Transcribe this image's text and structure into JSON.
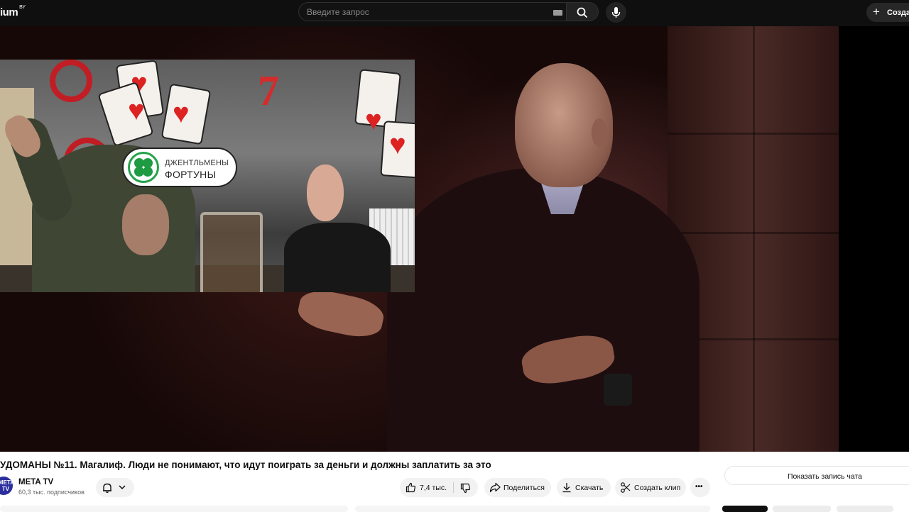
{
  "header": {
    "logo_text": "ium",
    "logo_sup": "BY",
    "search_placeholder": "Введите запрос",
    "create_label": "Создать"
  },
  "inset": {
    "badge_line1": "ДЖЕНТЛЬМЕНЫ",
    "badge_line2": "ФОРТУНЫ"
  },
  "video": {
    "title": "УДОМАНЫ №11. Магалиф. Люди не понимают, что идут поиграть за деньги и должны заплатить за это"
  },
  "channel": {
    "avatar_text": "META TV",
    "name": "META TV",
    "subscribers": "60,3 тыс. подписчиков"
  },
  "actions": {
    "like_count": "7,4 тыс.",
    "share_label": "Поделиться",
    "download_label": "Скачать",
    "clip_label": "Создать клип",
    "more_label": "•••"
  },
  "sidebar": {
    "show_chat_label": "Показать запись чата"
  },
  "colors": {
    "topbar": "#0f0f0f",
    "pill_bg": "#f2f2f2",
    "avatar": "#2b2e9e"
  }
}
